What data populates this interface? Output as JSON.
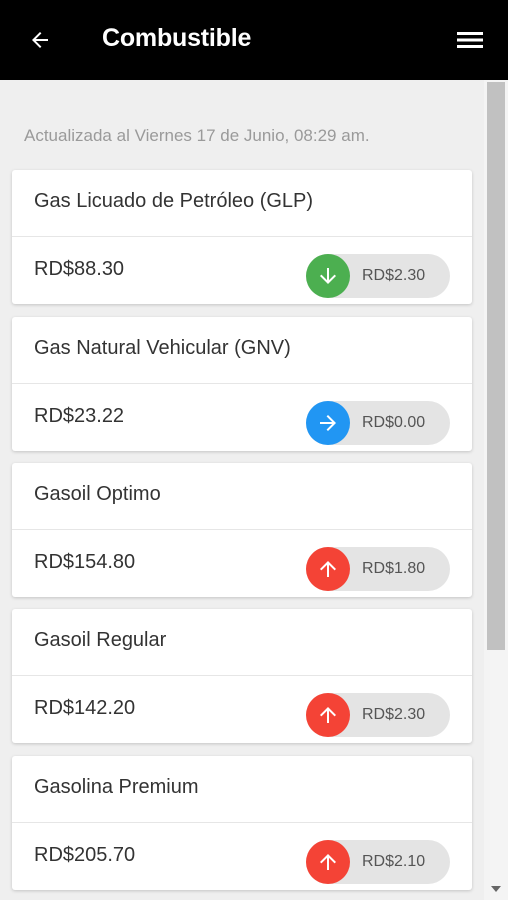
{
  "app_bar": {
    "title": "Combustible",
    "back_icon": "arrow-left-icon",
    "menu_icon": "hamburger-menu-icon"
  },
  "updated_text": "Actualizada al Viernes 17 de Junio, 08:29 am.",
  "colors": {
    "down": "#4caf50",
    "same": "#2196f3",
    "up": "#f44336"
  },
  "fuels": [
    {
      "name": "Gas Licuado de Petróleo (GLP)",
      "price": "RD$88.30",
      "change": "RD$2.30",
      "trend": "down",
      "icon": "arrow-down-icon"
    },
    {
      "name": "Gas Natural Vehicular (GNV)",
      "price": "RD$23.22",
      "change": "RD$0.00",
      "trend": "same",
      "icon": "arrow-right-icon"
    },
    {
      "name": "Gasoil Optimo",
      "price": "RD$154.80",
      "change": "RD$1.80",
      "trend": "up",
      "icon": "arrow-up-icon"
    },
    {
      "name": "Gasoil Regular",
      "price": "RD$142.20",
      "change": "RD$2.30",
      "trend": "up",
      "icon": "arrow-up-icon"
    },
    {
      "name": "Gasolina Premium",
      "price": "RD$205.70",
      "change": "RD$2.10",
      "trend": "up",
      "icon": "arrow-up-icon"
    }
  ]
}
